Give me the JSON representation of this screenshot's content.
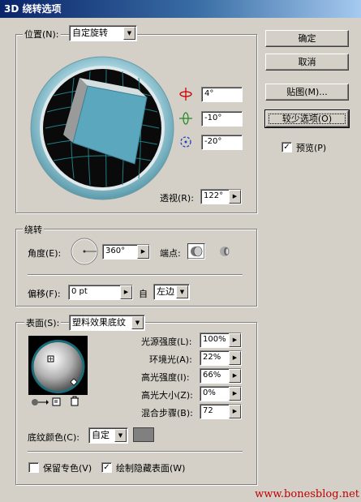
{
  "window": {
    "title": "3D 绕转选项"
  },
  "position": {
    "label": "位置(N):",
    "value": "自定旋转"
  },
  "rotation": {
    "x": "4°",
    "y": "-10°",
    "z": "-20°"
  },
  "perspective": {
    "label": "透视(R):",
    "value": "122°"
  },
  "buttons": {
    "ok": "确定",
    "cancel": "取消",
    "map": "贴图(M)...",
    "fewer": "较少选项(O)",
    "preview": "预览(P)"
  },
  "revolve": {
    "section": "绕转",
    "angle_label": "角度(E):",
    "angle_value": "360°",
    "cap_label": "端点:",
    "offset_label": "偏移(F):",
    "offset_value": "0 pt",
    "from_label": "自",
    "from_value": "左边"
  },
  "surface": {
    "label": "表面(S):",
    "value": "塑料效果底纹",
    "light_intensity_label": "光源强度(L):",
    "light_intensity": "100%",
    "ambient_label": "环境光(A):",
    "ambient": "22%",
    "highlight_intensity_label": "高光强度(I):",
    "highlight_intensity": "66%",
    "highlight_size_label": "高光大小(Z):",
    "highlight_size": "0%",
    "blend_steps_label": "混合步骤(B):",
    "blend_steps": "72",
    "shading_color_label": "底纹颜色(C):",
    "shading_color": "自定",
    "shading_swatch": "#808080"
  },
  "options": {
    "preserve_spot": "保留专色(V)",
    "draw_hidden": "绘制隐藏表面(W)"
  },
  "watermark": "www.bonesblog.net"
}
